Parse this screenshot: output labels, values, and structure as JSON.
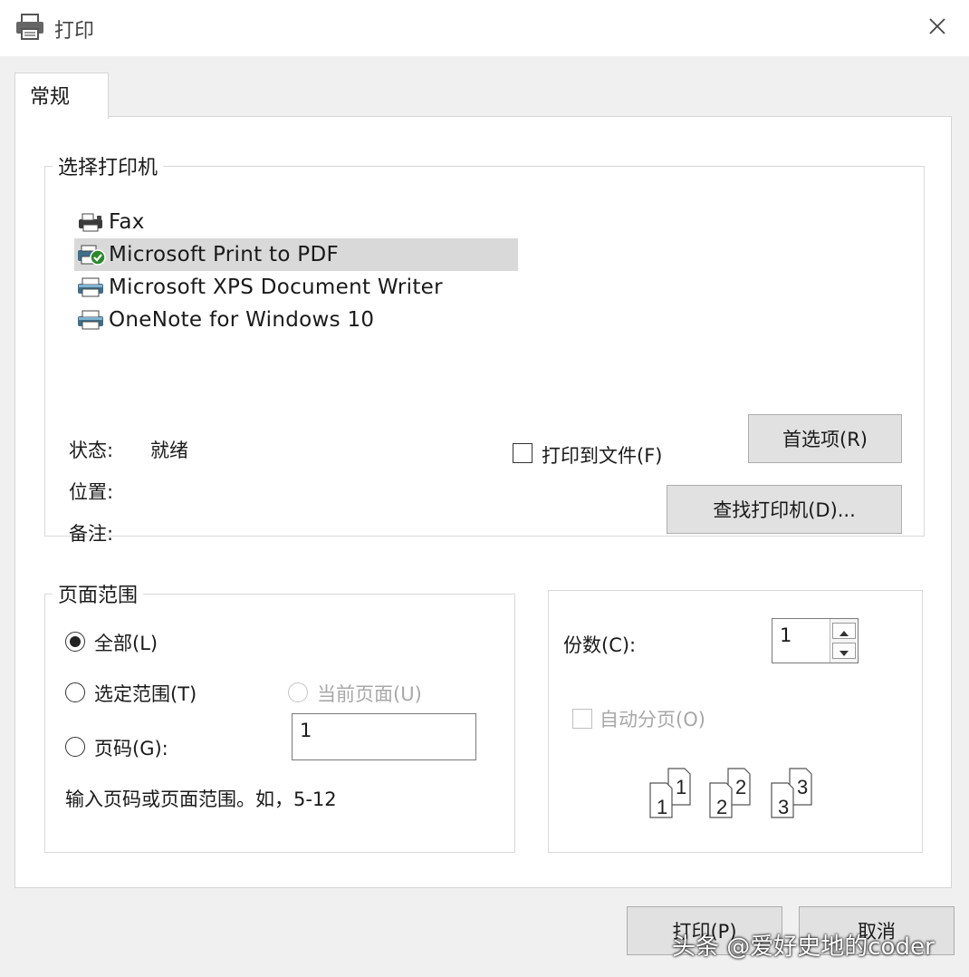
{
  "window": {
    "title": "打印",
    "icon": "printer-icon",
    "close_icon": "close-icon"
  },
  "tabs": [
    {
      "label": "常规"
    }
  ],
  "select_printer": {
    "legend": "选择打印机",
    "printers": [
      {
        "name": "Fax",
        "icon": "fax-printer-icon"
      },
      {
        "name": "Microsoft Print to PDF",
        "icon": "default-printer-icon",
        "selected": true
      },
      {
        "name": "Microsoft XPS Document Writer",
        "icon": "printer-icon"
      },
      {
        "name": "OneNote for Windows 10",
        "icon": "printer-icon"
      }
    ],
    "status_label": "状态:",
    "status_value": "就绪",
    "location_label": "位置:",
    "comment_label": "备注:",
    "print_to_file_label": "打印到文件(F)",
    "print_to_file_checked": false,
    "preferences_button": "首选项(R)",
    "find_printer_button": "查找打印机(D)..."
  },
  "page_range": {
    "legend": "页面范围",
    "all_label": "全部(L)",
    "selection_label": "选定范围(T)",
    "current_page_label": "当前页面(U)",
    "pages_label": "页码(G):",
    "pages_value": "1",
    "hint": "输入页码或页面范围。如，5-12",
    "selected_option": "all"
  },
  "copies": {
    "label": "份数(C):",
    "value": "1",
    "collate_label": "自动分页(O)",
    "collate_checked": false,
    "collate_pages": [
      "1",
      "1",
      "2",
      "2",
      "3",
      "3"
    ]
  },
  "footer": {
    "print_button": "打印(P)",
    "cancel_button": "取消",
    "watermark": "头条 @爱好史地的coder"
  },
  "colors": {
    "background": "#f0f0f0",
    "panel": "#ffffff",
    "selection": "#d9d9d9",
    "button": "#e1e1e1"
  }
}
